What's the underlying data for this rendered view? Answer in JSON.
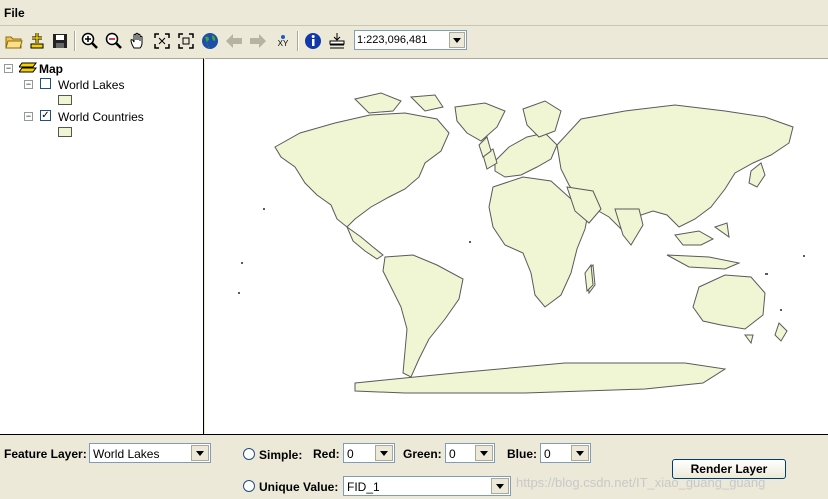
{
  "menu": {
    "file_label": "File"
  },
  "toolbar": {
    "icons": [
      "open-folder-icon",
      "add-data-icon",
      "save-icon",
      "zoom-in-icon",
      "zoom-out-icon",
      "pan-hand-icon",
      "full-extent-icon",
      "fixed-zoom-icon",
      "globe-icon",
      "back-arrow-icon",
      "forward-arrow-icon",
      "xy-coordinate-icon",
      "identify-info-icon",
      "layer-properties-icon"
    ],
    "xy_label": "XY",
    "scale_value": "1:223,096,481"
  },
  "toc": {
    "root_label": "Map",
    "layers": [
      {
        "label": "World Lakes",
        "checked": false,
        "check_glyph": ""
      },
      {
        "label": "World Countries",
        "checked": true,
        "check_glyph": "✓"
      }
    ]
  },
  "bottom": {
    "feature_layer_label": "Feature Layer:",
    "feature_layer_value": "World Lakes",
    "simple_label": "Simple:",
    "red_label": "Red:",
    "red_value": "0",
    "green_label": "Green:",
    "green_value": "0",
    "blue_label": "Blue:",
    "blue_value": "0",
    "unique_label": "Unique Value:",
    "unique_value": "FID_1",
    "render_button": "Render Layer"
  },
  "watermark": "https://blog.csdn.net/IT_xiao_guang_guang",
  "colors": {
    "land": "#f0f5d3",
    "border": "#5a5a5a"
  }
}
